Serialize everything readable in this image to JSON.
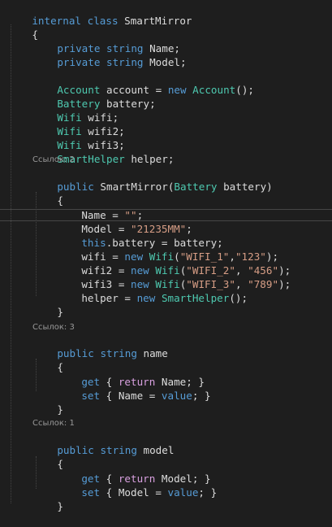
{
  "references": {
    "ctor": "Ссылок: 2",
    "name_prop": "Ссылок: 3",
    "model_prop": "Ссылок: 1"
  },
  "code": {
    "l01": [
      "internal",
      " ",
      "class",
      " SmartMirror"
    ],
    "l02": [
      "{"
    ],
    "l03": [
      "private",
      " ",
      "string",
      " Name;"
    ],
    "l04": [
      "private",
      " ",
      "string",
      " Model;"
    ],
    "l05": [
      "Account",
      " account = ",
      "new",
      " ",
      "Account",
      "();"
    ],
    "l06": [
      "Battery",
      " battery;"
    ],
    "l07": [
      "Wifi",
      " wifi;"
    ],
    "l08": [
      "Wifi",
      " wifi2;"
    ],
    "l09": [
      "Wifi",
      " wifi3;"
    ],
    "l10": [
      "SmartHelper",
      " helper;"
    ],
    "l11": [
      "public",
      " SmartMirror(",
      "Battery",
      " battery)"
    ],
    "l12": [
      "{"
    ],
    "l13": [
      "Name = ",
      "\"\"",
      ";"
    ],
    "l14": [
      "Model = ",
      "\"21235MM\"",
      ";"
    ],
    "l15": [
      "this",
      ".battery = battery;"
    ],
    "l16": [
      "wifi = ",
      "new",
      " ",
      "Wifi",
      "(",
      "\"WIFI_1\"",
      ",",
      "\"123\"",
      ");"
    ],
    "l17": [
      "wifi2 = ",
      "new",
      " ",
      "Wifi",
      "(",
      "\"WIFI_2\"",
      ", ",
      "\"456\"",
      ");"
    ],
    "l18": [
      "wifi3 = ",
      "new",
      " ",
      "Wifi",
      "(",
      "\"WIFI_3\"",
      ", ",
      "\"789\"",
      ");"
    ],
    "l19": [
      "helper = ",
      "new",
      " ",
      "SmartHelper",
      "();"
    ],
    "l20": [
      "}"
    ],
    "l21": [
      "public",
      " ",
      "string",
      " name"
    ],
    "l22": [
      "{"
    ],
    "l23": [
      "get",
      " { ",
      "return",
      " Name; }"
    ],
    "l24": [
      "set",
      " { Name = ",
      "value",
      "; }"
    ],
    "l25": [
      "}"
    ],
    "l26": [
      "public",
      " ",
      "string",
      " model"
    ],
    "l27": [
      "{"
    ],
    "l28": [
      "get",
      " { ",
      "return",
      " Model; }"
    ],
    "l29": [
      "set",
      " { Model = ",
      "value",
      "; }"
    ],
    "l30": [
      "}"
    ]
  },
  "colors": {
    "background": "#1e1e1e",
    "keyword": "#569cd6",
    "control_keyword": "#d8a0df",
    "type": "#4ec9b0",
    "string": "#d69d85",
    "plain": "#dcdcdc",
    "codelens": "#999999"
  }
}
